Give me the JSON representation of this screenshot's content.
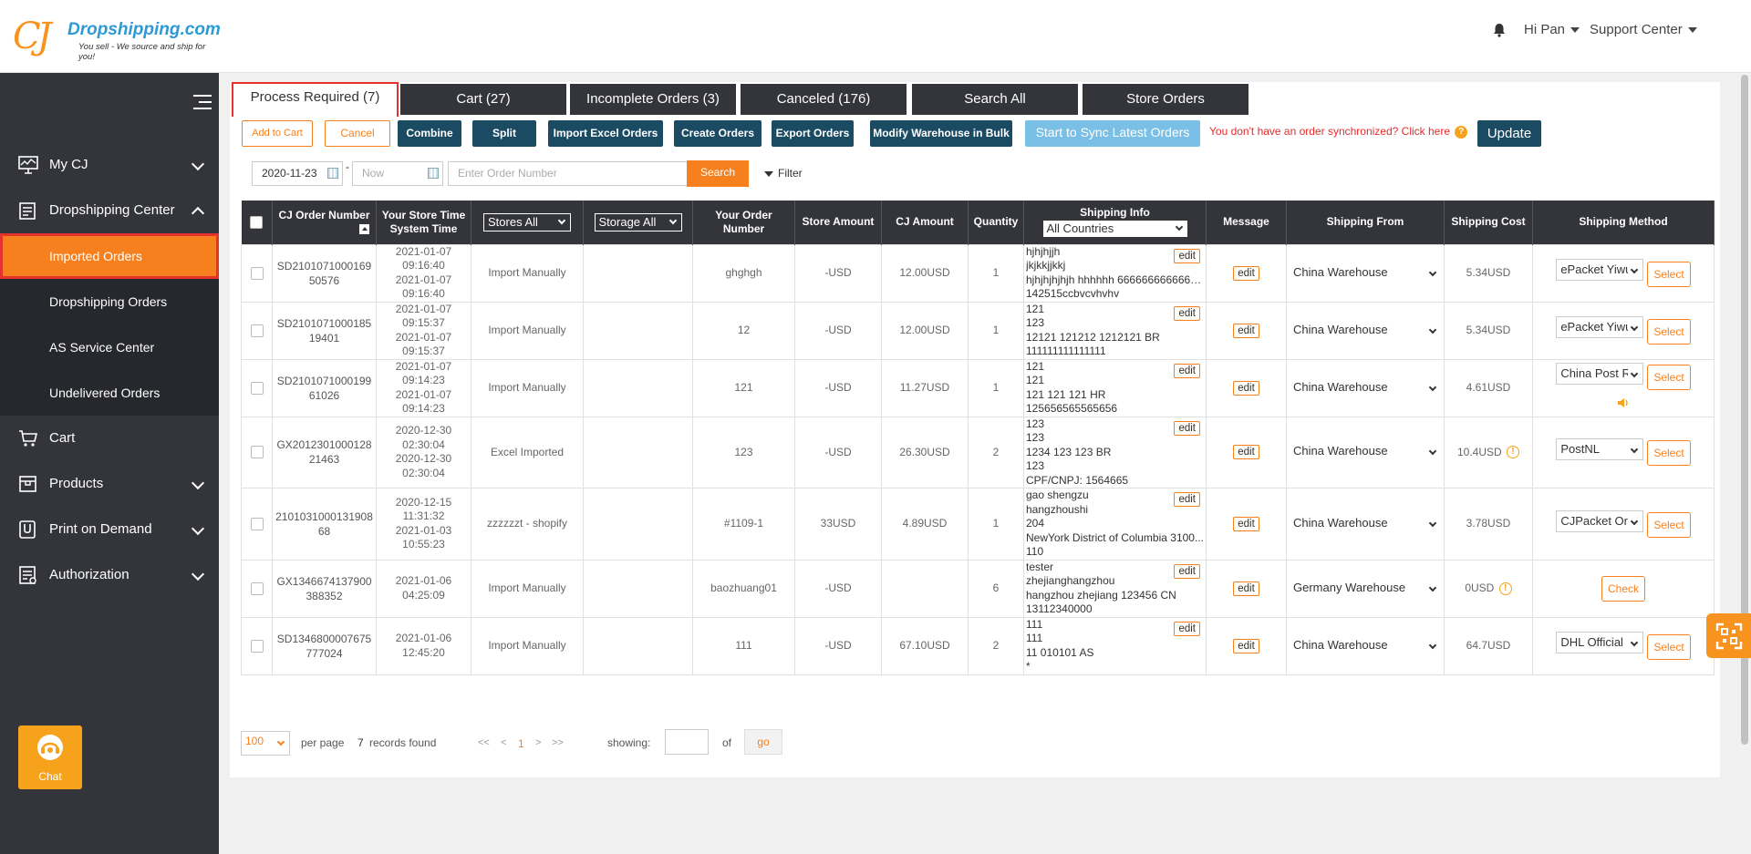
{
  "header": {
    "brand": "Dropshipping.com",
    "logo_mark": "CJ",
    "tagline": "You sell - We source and ship for you!",
    "greeting": "Hi Pan",
    "support": "Support Center",
    "icons": [
      "bell-icon",
      "chevron-down-icon"
    ]
  },
  "sidebar": {
    "items": [
      {
        "label": "My CJ",
        "icon": "monitor-icon"
      },
      {
        "label": "Dropshipping Center",
        "icon": "clipboard-icon"
      },
      {
        "label": "Imported Orders"
      },
      {
        "label": "Dropshipping Orders"
      },
      {
        "label": "AS Service Center"
      },
      {
        "label": "Undelivered Orders"
      },
      {
        "label": "Cart",
        "icon": "cart-icon"
      },
      {
        "label": "Products",
        "icon": "box-icon"
      },
      {
        "label": "Print on Demand",
        "icon": "print-icon"
      },
      {
        "label": "Authorization",
        "icon": "list-icon"
      }
    ],
    "chat_label": "Chat"
  },
  "tabs": [
    "Process Required (7)",
    "Cart (27)",
    "Incomplete Orders (3)",
    "Canceled (176)",
    "Search All",
    "Store Orders"
  ],
  "toolbar": {
    "add_to_cart": "Add to Cart",
    "cancel": "Cancel",
    "combine": "Combine",
    "split": "Split",
    "import_excel": "Import Excel Orders",
    "create_orders": "Create Orders",
    "export_orders": "Export Orders",
    "modify_warehouse": "Modify Warehouse in Bulk",
    "sync": "Start to Sync Latest Orders",
    "sync_hint": "You don't have an order synchronized? Click here",
    "update": "Update"
  },
  "filters": {
    "date_from": "2020-11-23",
    "date_sep": "-",
    "date_to_placeholder": "Now",
    "order_placeholder": "Enter Order Number",
    "search": "Search",
    "filter": "Filter"
  },
  "table": {
    "headers": {
      "cj_order": "CJ Order Number",
      "store_time": "Your Store Time",
      "system_time": "System Time",
      "stores": "Stores All",
      "storage": "Storage All",
      "your_order": "Your Order Number",
      "store_amount": "Store Amount",
      "cj_amount": "CJ Amount",
      "quantity": "Quantity",
      "shipping_info": "Shipping Info",
      "countries": "All Countries",
      "message": "Message",
      "shipping_from": "Shipping From",
      "shipping_cost": "Shipping Cost",
      "shipping_method": "Shipping Method"
    },
    "edit_label": "edit",
    "select_label": "Select",
    "check_label": "Check",
    "rows": [
      {
        "cj_order": "SD210107100016950576",
        "store_time": "2021-01-07 09:16:40",
        "system_time": "2021-01-07 09:16:40",
        "store": "Import Manually",
        "your_order": "ghghgh",
        "store_amount": "-USD",
        "cj_amount": "12.00USD",
        "qty": "1",
        "ship_info": [
          "hjhjhjjh",
          "jkjkkjjkkj",
          "hjhjhjhjhjh hhhhhh 66666666666666...",
          "142515ccbvcvhvhv"
        ],
        "from": "China Warehouse",
        "cost": "5.34USD",
        "method": "ePacket Yiwu"
      },
      {
        "cj_order": "SD210107100018519401",
        "store_time": "2021-01-07 09:15:37",
        "system_time": "2021-01-07 09:15:37",
        "store": "Import Manually",
        "your_order": "12",
        "store_amount": "-USD",
        "cj_amount": "12.00USD",
        "qty": "1",
        "ship_info": [
          "121",
          "123",
          "12121 121212 1212121 BR",
          "111111111111111"
        ],
        "from": "China Warehouse",
        "cost": "5.34USD",
        "method": "ePacket Yiwu"
      },
      {
        "cj_order": "SD210107100019961026",
        "store_time": "2021-01-07 09:14:23",
        "system_time": "2021-01-07 09:14:23",
        "store": "Import Manually",
        "your_order": "121",
        "store_amount": "-USD",
        "cj_amount": "11.27USD",
        "qty": "1",
        "ship_info": [
          "121",
          "121",
          "121 121 121 HR",
          "125656565565656"
        ],
        "from": "China Warehouse",
        "cost": "4.61USD",
        "method": "China Post Registered"
      },
      {
        "cj_order": "GX201230100012821463",
        "store_time": "2020-12-30 02:30:04",
        "system_time": "2020-12-30 02:30:04",
        "store": "Excel Imported",
        "your_order": "123",
        "store_amount": "-USD",
        "cj_amount": "26.30USD",
        "qty": "2",
        "ship_info": [
          "123",
          "123",
          "1234 123 123 BR",
          "123",
          "CPF/CNPJ: 1564665"
        ],
        "from": "China Warehouse",
        "cost": "10.4USD",
        "method": "PostNL"
      },
      {
        "cj_order": "210103100013190868",
        "store_time": "2020-12-15 11:31:32",
        "system_time": "2021-01-03 10:55:23",
        "store": "zzzzzzt - shopify",
        "your_order": "#1109-1",
        "store_amount": "33USD",
        "cj_amount": "4.89USD",
        "qty": "1",
        "ship_info": [
          "gao shengzu",
          "hangzhoushi",
          "204",
          "NewYork District of Columbia 3100...",
          "110"
        ],
        "from": "China Warehouse",
        "cost": "3.78USD",
        "method": "CJPacket Ordinary"
      },
      {
        "cj_order": "GX1346674137900388352",
        "store_time": "2021-01-06 04:25:09",
        "system_time": "",
        "store": "Import Manually",
        "your_order": "baozhuang01",
        "store_amount": "-USD",
        "cj_amount": "",
        "qty": "6",
        "ship_info": [
          "tester",
          "zhejianghangzhou",
          "hangzhou zhejiang 123456 CN",
          "13112340000"
        ],
        "from": "Germany Warehouse",
        "cost": "0USD",
        "method": ""
      },
      {
        "cj_order": "SD1346800007675777024",
        "store_time": "2021-01-06 12:45:20",
        "system_time": "",
        "store": "Import Manually",
        "your_order": "111",
        "store_amount": "-USD",
        "cj_amount": "67.10USD",
        "qty": "2",
        "ship_info": [
          "111",
          "111",
          "11 010101 AS",
          "*"
        ],
        "from": "China Warehouse",
        "cost": "64.7USD",
        "method": "DHL Official"
      }
    ]
  },
  "pagination": {
    "per_page_value": "100",
    "per_page": "per page",
    "records_count": "7",
    "records_found": "records found",
    "first": "<<",
    "prev": "<",
    "current": "1",
    "next": ">",
    "last": ">>",
    "showing": "showing:",
    "of": "of",
    "go": "go"
  },
  "colors": {
    "accent": "#f7801e",
    "dark": "#34353b",
    "button_dark": "#1b4b63",
    "active_border": "#e5322d",
    "sync": "#79bfe6"
  }
}
